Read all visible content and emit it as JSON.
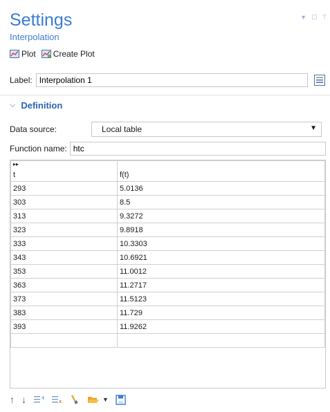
{
  "header": {
    "title": "Settings",
    "subtitle": "Interpolation"
  },
  "toolbar": {
    "plot_label": "Plot",
    "create_plot_label": "Create Plot"
  },
  "label_field": {
    "label": "Label:",
    "value": "Interpolation 1"
  },
  "section": {
    "title": "Definition"
  },
  "data_source": {
    "label": "Data source:",
    "value": "Local table"
  },
  "function_name": {
    "label": "Function name:",
    "value": "htc"
  },
  "table": {
    "columns": [
      "t",
      "f(t)"
    ],
    "rows": [
      [
        "293",
        "5.0136"
      ],
      [
        "303",
        "8.5"
      ],
      [
        "313",
        "9.3272"
      ],
      [
        "323",
        "9.8918"
      ],
      [
        "333",
        "10.3303"
      ],
      [
        "343",
        "10.6921"
      ],
      [
        "353",
        "11.0012"
      ],
      [
        "363",
        "11.2717"
      ],
      [
        "373",
        "11.5123"
      ],
      [
        "383",
        "11.729"
      ],
      [
        "393",
        "11.9262"
      ],
      [
        "",
        ""
      ]
    ]
  },
  "icons": {
    "plot": "plot-icon",
    "create_plot": "create-plot-icon",
    "move_up": "arrow-up-icon",
    "move_down": "arrow-down-icon",
    "insert": "insert-rows-icon",
    "clear": "clear-table-icon",
    "edit": "brush-icon",
    "open": "folder-open-icon",
    "save": "save-icon"
  }
}
